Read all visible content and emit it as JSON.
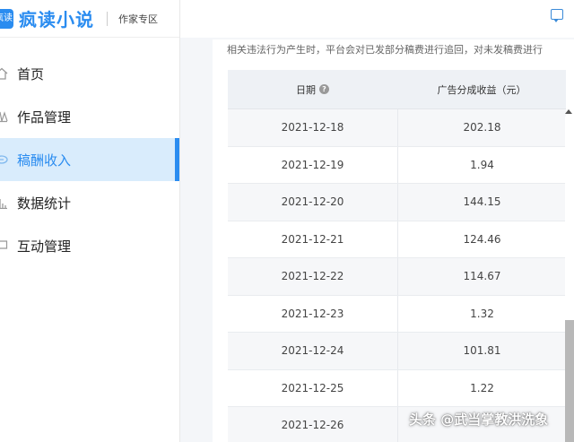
{
  "app": {
    "logo_badge": "疯读",
    "logo_text": "疯读小说",
    "section": "作家专区"
  },
  "sidebar": {
    "items": [
      {
        "label": "首页",
        "icon": "home-icon"
      },
      {
        "label": "作品管理",
        "icon": "book-icon"
      },
      {
        "label": "稿酬收入",
        "icon": "income-icon",
        "active": true
      },
      {
        "label": "数据统计",
        "icon": "bar-chart-icon"
      },
      {
        "label": "互动管理",
        "icon": "chat-icon"
      }
    ]
  },
  "notice": {
    "text": "相关违法行为产生时，平台会对已发部分稿费进行追回，对未发稿费进行"
  },
  "table": {
    "headers": {
      "date": "日期",
      "revenue": "广告分成收益（元）"
    },
    "rows": [
      {
        "date": "2021-12-18",
        "revenue": "202.18"
      },
      {
        "date": "2021-12-19",
        "revenue": "1.94"
      },
      {
        "date": "2021-12-20",
        "revenue": "144.15"
      },
      {
        "date": "2021-12-21",
        "revenue": "124.46"
      },
      {
        "date": "2021-12-22",
        "revenue": "114.67"
      },
      {
        "date": "2021-12-23",
        "revenue": "1.32"
      },
      {
        "date": "2021-12-24",
        "revenue": "101.81"
      },
      {
        "date": "2021-12-25",
        "revenue": "1.22"
      },
      {
        "date": "2021-12-26",
        "revenue": ""
      }
    ]
  },
  "watermark": "头条 @武当掌教洪洗象",
  "colors": {
    "accent": "#2a8cf0",
    "active_bg": "#d9ecfc"
  }
}
